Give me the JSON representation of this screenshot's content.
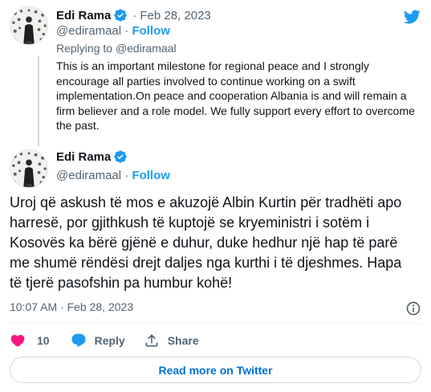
{
  "parent_tweet": {
    "author_name": "Edi Rama",
    "separator": "·",
    "date": "Feb 28, 2023",
    "handle": "@ediramaal",
    "handle_separator": "·",
    "follow_label": "Follow",
    "replying_prefix": "Replying to",
    "replying_to": "@ediramaal",
    "text": "This is an important milestone for regional peace and I strongly encourage all parties involved to continue working on a swift implementation.On peace and cooperation Albania is and will remain a firm believer and a role model. We fully support every effort to overcome the past."
  },
  "main_tweet": {
    "author_name": "Edi Rama",
    "handle": "@ediramaal",
    "handle_separator": "·",
    "follow_label": "Follow",
    "text": "Uroj që askush të mos e akuzojë Albin Kurtin për tradhëti apo harresë, por gjithkush të kuptojë se kryeministri i sotëm i Kosovës ka bërë gjënë e duhur, duke hedhur një hap të parë me shumë rëndësi drejt daljes nga kurthi i të djeshmes. Hapa të tjerë pasofshin pa humbur kohë!",
    "timestamp": "10:07 AM · Feb 28, 2023"
  },
  "actions": {
    "like_count": "10",
    "reply_label": "Reply",
    "share_label": "Share"
  },
  "read_more_label": "Read more on Twitter",
  "icons": {
    "verified": "verified-badge-icon",
    "logo": "twitter-bird-icon",
    "info": "info-icon",
    "like": "heart-icon",
    "reply": "speech-bubble-icon",
    "share": "share-arrow-icon"
  },
  "colors": {
    "accent": "#1d9bf0",
    "like": "#f91880",
    "text": "#0f1419",
    "muted": "#536471",
    "link": "#006fd6"
  }
}
